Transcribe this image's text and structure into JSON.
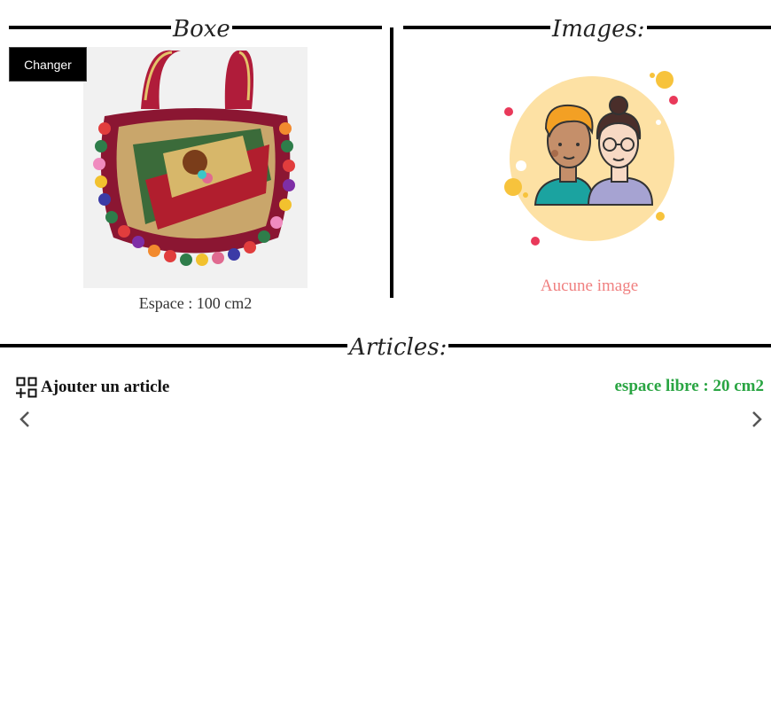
{
  "boxe": {
    "title": "Boxe",
    "change_label": "Changer",
    "space_text": "Espace : 100 cm2"
  },
  "images": {
    "title": "Images:",
    "empty_text": "Aucune image"
  },
  "articles": {
    "title": "Articles:",
    "add_label": "Ajouter un article",
    "free_space": "espace libre : 20 cm2"
  },
  "icons": {
    "add": "add-grid-icon",
    "prev": "chevron-left-icon",
    "next": "chevron-right-icon"
  },
  "colors": {
    "free_space": "#2aa543",
    "empty_text": "#f08080",
    "button_bg": "#000000"
  }
}
